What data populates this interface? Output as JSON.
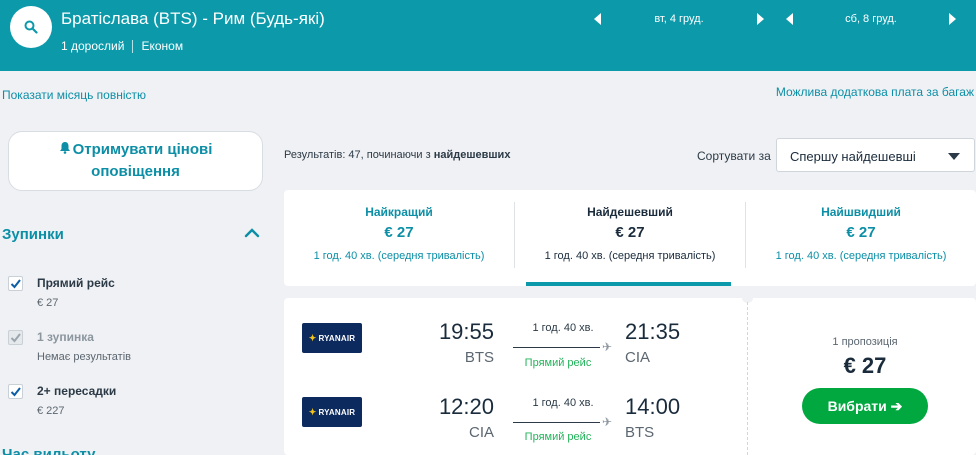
{
  "header": {
    "route": "Братіслава (BTS) - Рим (Будь-які)",
    "passengers": "1 дорослий",
    "cabin": "Економ",
    "depart_date": "вт, 4 груд.",
    "return_date": "сб, 8 груд.",
    "accent_color": "#0c9aab"
  },
  "links": {
    "show_month": "Показати місяць повністю",
    "baggage": "Можлива додаткова плата за багаж"
  },
  "sidebar": {
    "alert_line1": "Отримувати цінові",
    "alert_line2": "оповіщення",
    "stops_title": "Зупинки",
    "filters": [
      {
        "label": "Прямий рейс",
        "sub": "€ 27",
        "checked": true,
        "disabled": false
      },
      {
        "label": "1 зупинка",
        "sub": "Немає результатів",
        "checked": true,
        "disabled": true
      },
      {
        "label": "2+ пересадки",
        "sub": "€ 227",
        "checked": true,
        "disabled": false
      }
    ],
    "next_section": "Час вильоту"
  },
  "results": {
    "count_prefix": "Результатів: 47, починаючи з ",
    "count_emph": "найдешевших",
    "sort_label": "Сортувати за",
    "sort_value": "Спершу найдешевші"
  },
  "tabs": [
    {
      "name": "Найкращий",
      "price": "€ 27",
      "duration": "1 год. 40 хв. (середня тривалість)"
    },
    {
      "name": "Найдешевший",
      "price": "€ 27",
      "duration": "1 год. 40 хв. (середня тривалість)"
    },
    {
      "name": "Найшвидший",
      "price": "€ 27",
      "duration": "1 год. 40 хв. (середня тривалість)"
    }
  ],
  "card": {
    "legs": [
      {
        "airline": "RYANAIR",
        "dep_time": "19:55",
        "dep_apt": "BTS",
        "duration": "1 год. 40 хв.",
        "stops": "Прямий рейс",
        "arr_time": "21:35",
        "arr_apt": "CIA"
      },
      {
        "airline": "RYANAIR",
        "dep_time": "12:20",
        "dep_apt": "CIA",
        "duration": "1 год. 40 хв.",
        "stops": "Прямий рейс",
        "arr_time": "14:00",
        "arr_apt": "BTS"
      }
    ],
    "offers": "1 пропозиція",
    "price": "€ 27",
    "select_label": "Вибрати ➔"
  }
}
